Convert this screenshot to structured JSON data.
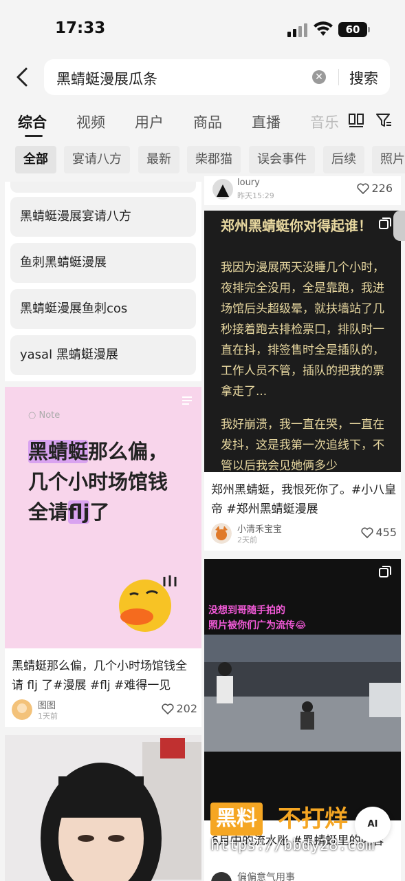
{
  "status_bar": {
    "time": "17:33",
    "battery": "60"
  },
  "search": {
    "query": "黑蜻蜓漫展瓜条",
    "clear_icon": "clear-icon",
    "button_label": "搜索"
  },
  "tabs": [
    {
      "label": "综合",
      "active": true
    },
    {
      "label": "视频"
    },
    {
      "label": "用户"
    },
    {
      "label": "商品"
    },
    {
      "label": "直播"
    },
    {
      "label": "音乐"
    }
  ],
  "chips": [
    {
      "label": "全部",
      "active": true
    },
    {
      "label": "宴请八方"
    },
    {
      "label": "最新"
    },
    {
      "label": "柴郡猫"
    },
    {
      "label": "误会事件"
    },
    {
      "label": "后续"
    },
    {
      "label": "照片"
    }
  ],
  "suggestions": [
    "黑蜻蜓漫展宴请八方",
    "鱼刺黑蜻蜓漫展",
    "黑蜻蜓漫展鱼刺cos",
    "yasal 黑蜻蜓漫展"
  ],
  "left_note": {
    "tag": "Note",
    "big_text_hl": "黑蜻蜓",
    "big_text_1": "那么偏，几个小时场馆钱全请",
    "big_text_hl2": "flj",
    "big_text_2": "了",
    "title": "黑蜻蜓那么偏，几个小时场馆钱全请 flj 了#漫展 #flj #难得一见",
    "author": "图图",
    "time": "1天前",
    "likes": "202"
  },
  "right_prev": {
    "author": "loury",
    "time": "昨天15:29",
    "likes": "226"
  },
  "right_text_card": {
    "heading": "郑州黑蜻蜓你对得起谁！",
    "body": "我因为漫展两天没睡几个小时，夜排完全没用，全是靠跑，我进场馆后头超级晕，就扶墙站了几秒接着跑去排检票口，排队时一直在抖，排签售时全是插队的，工作人员不管，插队的把我的票拿走了...",
    "body2": "我好崩溃，我一直在哭，一直在发抖，这是我第一次追线下，不管以后我会见她俩多少",
    "title": "郑州黑蜻蜓，我恨死你了。#小八皇帝 #郑州黑蜻蜓漫展",
    "author": "小清禾宝宝",
    "time": "2天前",
    "likes": "455"
  },
  "right_video_card": {
    "caption_1": "没想到哥随手拍的",
    "caption_2": "照片被你们广为流传😂",
    "title": "6月中的流水账 #黑蜻蜓里的内容",
    "author": "偏偏意气用事"
  },
  "watermark": {
    "logo_1": "黑料",
    "logo_2": "不打烊",
    "url": "https://bbdy28.com"
  },
  "ai_button": "AI"
}
